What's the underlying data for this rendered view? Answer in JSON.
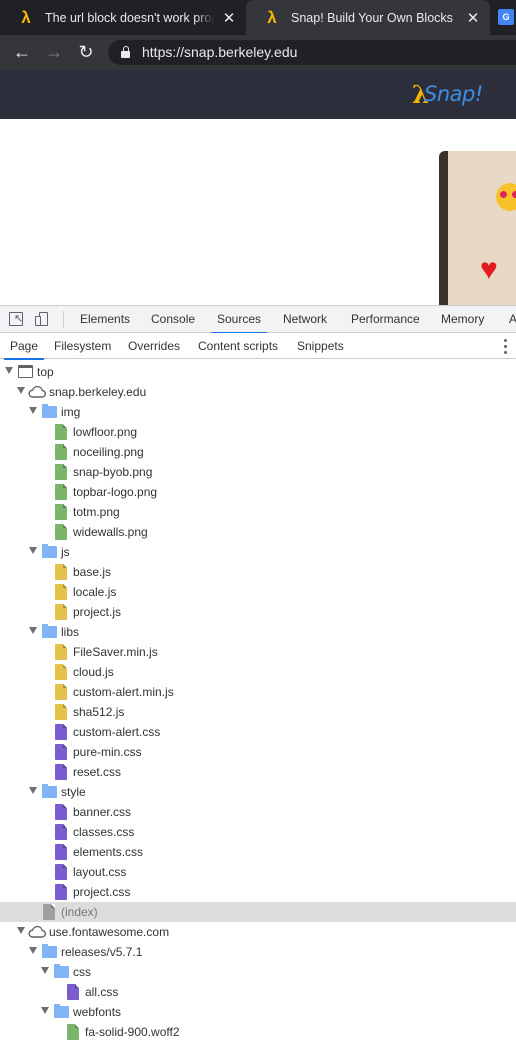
{
  "browser": {
    "tabs": [
      {
        "title": "The url block doesn't work properly",
        "favicon": "lambda-icon",
        "active": false
      },
      {
        "title": "Snap! Build Your Own Blocks",
        "favicon": "lambda-icon",
        "active": true
      }
    ],
    "close_glyph": "✕",
    "url": "https://snap.berkeley.edu"
  },
  "website": {
    "logo_lambda": "λ",
    "logo_text": "Snap!",
    "header_color": "#2d2e3b"
  },
  "devtools": {
    "panel_tabs": [
      "Elements",
      "Console",
      "Sources",
      "Network",
      "Performance",
      "Memory",
      "A"
    ],
    "active_panel": "Sources",
    "navigator_tabs": [
      "Page",
      "Filesystem",
      "Overrides",
      "Content scripts",
      "Snippets"
    ],
    "active_navigator": "Page",
    "accent_color": "#1a73e8",
    "tree": [
      {
        "label": "top",
        "icon": "frame-icon"
      },
      {
        "label": "snap.berkeley.edu",
        "icon": "cloud-icon"
      },
      {
        "label": "img",
        "icon": "folder-icon"
      },
      {
        "label": "lowfloor.png",
        "icon": "image-file-icon"
      },
      {
        "label": "noceiling.png",
        "icon": "image-file-icon"
      },
      {
        "label": "snap-byob.png",
        "icon": "image-file-icon"
      },
      {
        "label": "topbar-logo.png",
        "icon": "image-file-icon"
      },
      {
        "label": "totm.png",
        "icon": "image-file-icon"
      },
      {
        "label": "widewalls.png",
        "icon": "image-file-icon"
      },
      {
        "label": "js",
        "icon": "folder-icon"
      },
      {
        "label": "base.js",
        "icon": "script-file-icon"
      },
      {
        "label": "locale.js",
        "icon": "script-file-icon"
      },
      {
        "label": "project.js",
        "icon": "script-file-icon"
      },
      {
        "label": "libs",
        "icon": "folder-icon"
      },
      {
        "label": "FileSaver.min.js",
        "icon": "script-file-icon"
      },
      {
        "label": "cloud.js",
        "icon": "script-file-icon"
      },
      {
        "label": "custom-alert.min.js",
        "icon": "script-file-icon"
      },
      {
        "label": "sha512.js",
        "icon": "script-file-icon"
      },
      {
        "label": "custom-alert.css",
        "icon": "stylesheet-file-icon"
      },
      {
        "label": "pure-min.css",
        "icon": "stylesheet-file-icon"
      },
      {
        "label": "reset.css",
        "icon": "stylesheet-file-icon"
      },
      {
        "label": "style",
        "icon": "folder-icon"
      },
      {
        "label": "banner.css",
        "icon": "stylesheet-file-icon"
      },
      {
        "label": "classes.css",
        "icon": "stylesheet-file-icon"
      },
      {
        "label": "elements.css",
        "icon": "stylesheet-file-icon"
      },
      {
        "label": "layout.css",
        "icon": "stylesheet-file-icon"
      },
      {
        "label": "project.css",
        "icon": "stylesheet-file-icon"
      },
      {
        "label": "(index)",
        "icon": "document-file-icon",
        "selected": true
      },
      {
        "label": "use.fontawesome.com",
        "icon": "cloud-icon"
      },
      {
        "label": "releases/v5.7.1",
        "icon": "folder-icon"
      },
      {
        "label": "css",
        "icon": "folder-icon"
      },
      {
        "label": "all.css",
        "icon": "stylesheet-file-icon"
      },
      {
        "label": "webfonts",
        "icon": "folder-icon"
      },
      {
        "label": "fa-solid-900.woff2",
        "icon": "font-file-icon"
      }
    ]
  }
}
